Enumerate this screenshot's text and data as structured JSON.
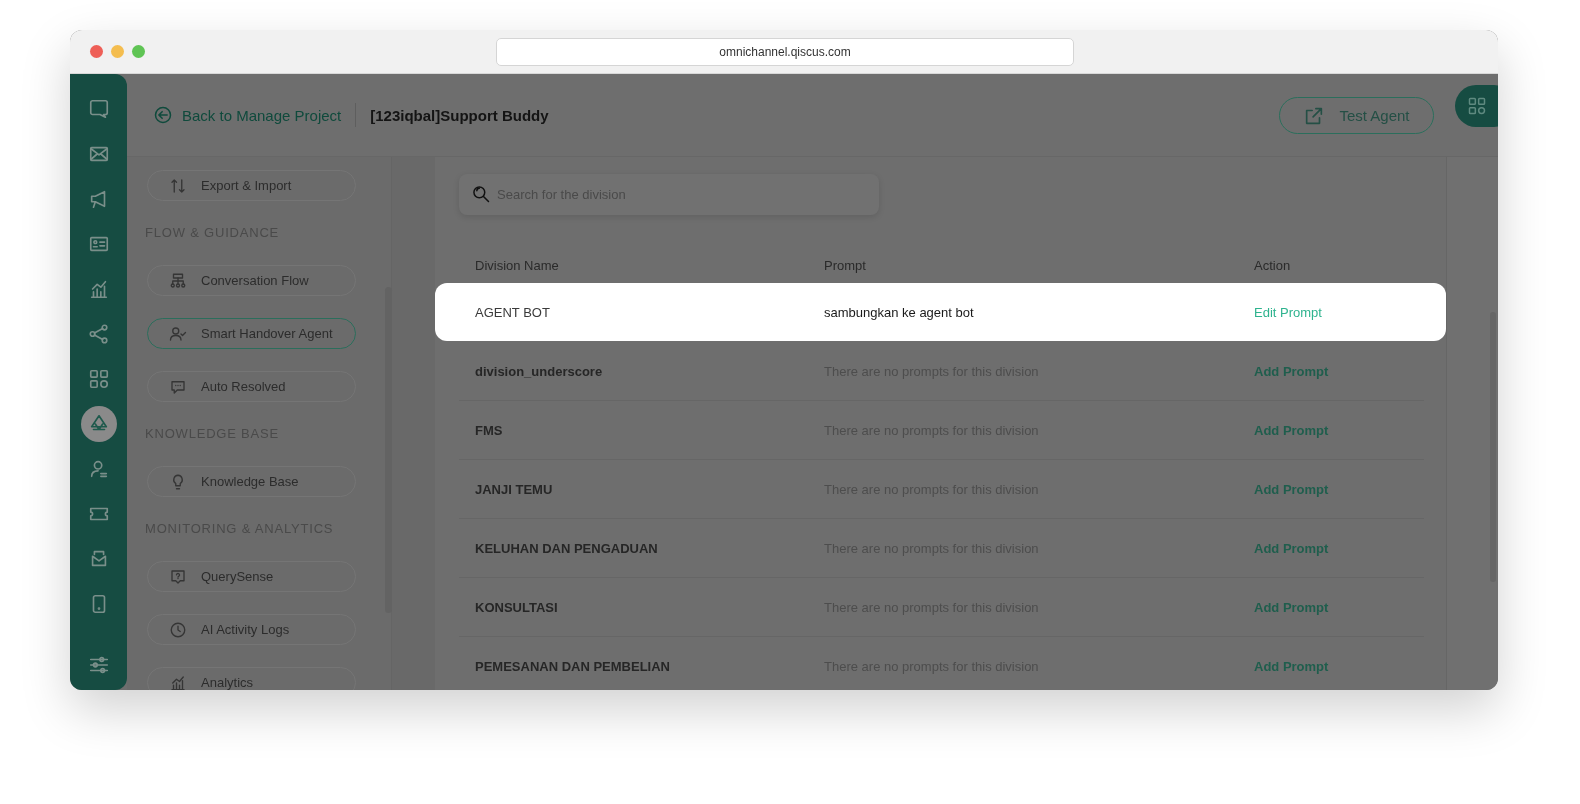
{
  "browser": {
    "url": "omnichannel.qiscus.com"
  },
  "rail_items": [
    {
      "selected": false
    },
    {
      "selected": false
    },
    {
      "selected": false
    },
    {
      "selected": false
    },
    {
      "selected": false
    },
    {
      "selected": false
    },
    {
      "selected": false
    },
    {
      "selected": true
    },
    {
      "selected": false
    },
    {
      "selected": false
    },
    {
      "selected": false
    },
    {
      "selected": false
    },
    {
      "selected": false
    }
  ],
  "header": {
    "back_link": "Back to Manage Project",
    "project_title": "[123iqbal]Support Buddy",
    "test_button": "Test Agent"
  },
  "sidebar": [
    {
      "kind": "item",
      "label": "Export & Import",
      "selected": false
    },
    {
      "kind": "heading",
      "label": "FLOW & GUIDANCE"
    },
    {
      "kind": "item",
      "label": "Conversation Flow",
      "selected": false
    },
    {
      "kind": "item",
      "label": "Smart Handover Agent",
      "selected": true
    },
    {
      "kind": "item",
      "label": "Auto Resolved",
      "selected": false
    },
    {
      "kind": "heading",
      "label": "KNOWLEDGE BASE"
    },
    {
      "kind": "item",
      "label": "Knowledge Base",
      "selected": false
    },
    {
      "kind": "heading",
      "label": "MONITORING & ANALYTICS"
    },
    {
      "kind": "item",
      "label": "QuerySense",
      "selected": false
    },
    {
      "kind": "item",
      "label": "AI Activity Logs",
      "selected": false
    },
    {
      "kind": "item",
      "label": "Analytics",
      "selected": false
    }
  ],
  "search": {
    "placeholder": "Search for the division"
  },
  "table": {
    "columns": [
      "Division Name",
      "Prompt",
      "Action"
    ],
    "rows": [
      {
        "name": "AGENT BOT",
        "prompt": "sambungkan ke agent bot",
        "action": "Edit Prompt",
        "highlighted": true
      },
      {
        "name": "division_underscore",
        "prompt": "There are no prompts for this division",
        "action": "Add Prompt",
        "highlighted": false
      },
      {
        "name": "FMS",
        "prompt": "There are no prompts for this division",
        "action": "Add Prompt",
        "highlighted": false
      },
      {
        "name": "JANJI TEMU",
        "prompt": "There are no prompts for this division",
        "action": "Add Prompt",
        "highlighted": false
      },
      {
        "name": "KELUHAN DAN PENGADUAN",
        "prompt": "There are no prompts for this division",
        "action": "Add Prompt",
        "highlighted": false
      },
      {
        "name": "KONSULTASI",
        "prompt": "There are no prompts for this division",
        "action": "Add Prompt",
        "highlighted": false
      },
      {
        "name": "PEMESANAN DAN PEMBELIAN",
        "prompt": "There are no prompts for this division",
        "action": "Add Prompt",
        "highlighted": false
      }
    ]
  }
}
